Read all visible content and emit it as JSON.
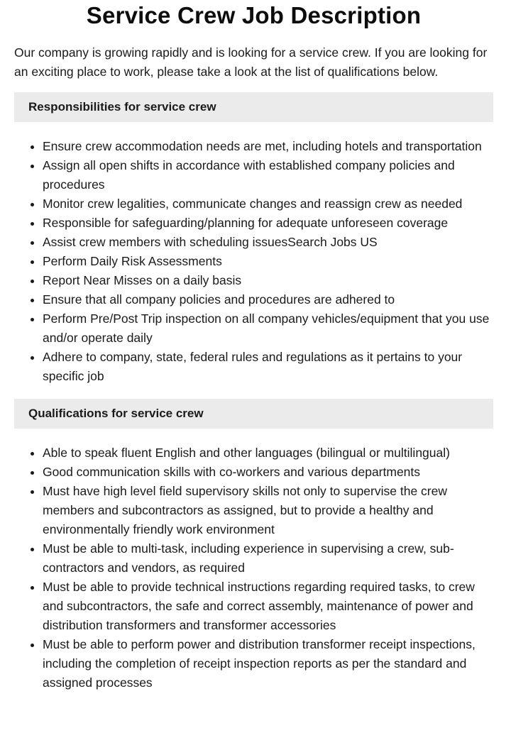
{
  "page": {
    "title": "Service Crew Job Description",
    "intro": "Our company is growing rapidly and is looking for a service crew. If you are looking for an exciting place to work, please take a look at the list of qualifications below."
  },
  "sections": [
    {
      "header": "Responsibilities for service crew",
      "items": [
        "Ensure crew accommodation needs are met, including hotels and transportation",
        "Assign all open shifts in accordance with established company policies and procedures",
        "Monitor crew legalities, communicate changes and reassign crew as needed",
        "Responsible for safeguarding/planning for adequate unforeseen coverage",
        "Assist crew members with scheduling issuesSearch Jobs US",
        "Perform Daily Risk Assessments",
        "Report Near Misses on a daily basis",
        "Ensure that all company policies and procedures are adhered to",
        "Perform Pre/Post Trip inspection on all company vehicles/equipment that you use and/or operate daily",
        "Adhere to company, state, federal rules and regulations as it pertains to your specific job"
      ]
    },
    {
      "header": "Qualifications for service crew",
      "items": [
        "Able to speak fluent English and other languages (bilingual or multilingual)",
        "Good communication skills with co-workers and various departments",
        "Must have high level field supervisory skills not only to supervise the crew members and subcontractors as assigned, but to provide a healthy and environmentally friendly work environment",
        "Must be able to multi-task, including experience in supervising a crew, sub-contractors and vendors, as required",
        "Must be able to provide technical instructions regarding required tasks, to crew and subcontractors, the safe and correct assembly, maintenance of power and distribution transformers and transformer accessories",
        "Must be able to perform power and distribution transformer receipt inspections, including the completion of receipt inspection reports as per the standard and assigned processes"
      ]
    }
  ]
}
